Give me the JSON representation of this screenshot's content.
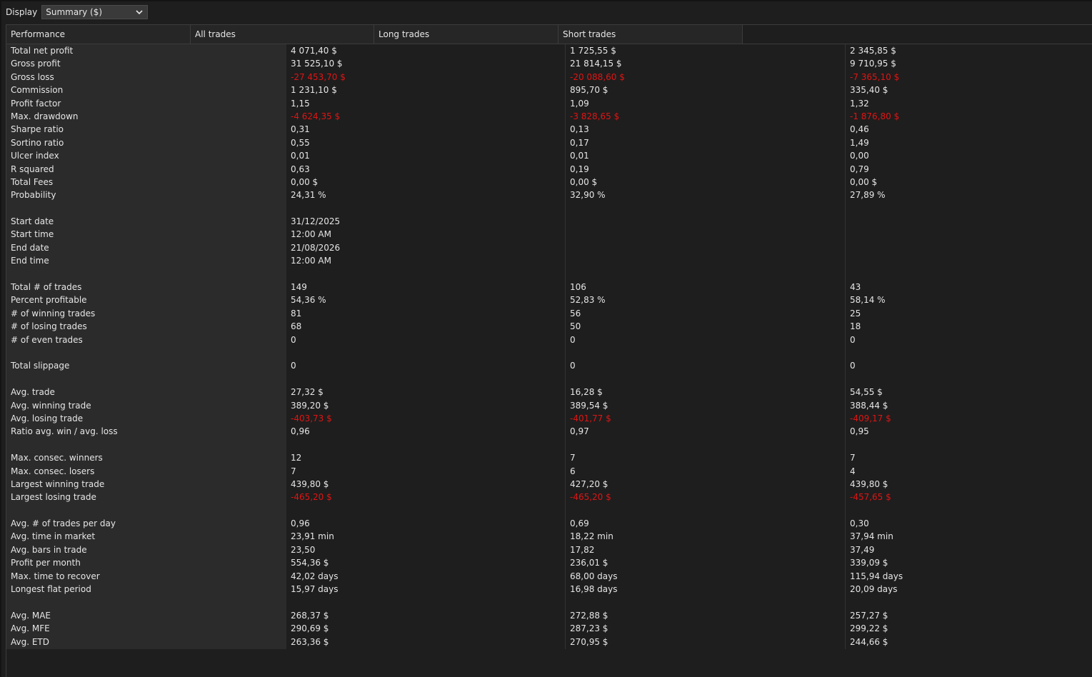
{
  "toolbar": {
    "display_label": "Display",
    "display_value": "Summary ($)"
  },
  "columns": [
    "Performance",
    "All trades",
    "Long trades",
    "Short trades"
  ],
  "colors": {
    "negative": "#e01414",
    "text": "#e6e6e6",
    "background": "#1e1e1e",
    "label_column": "#2b2b2b"
  },
  "rows": [
    {
      "label": "Total net profit",
      "all": "4 071,40 $",
      "long": "1 725,55 $",
      "short": "2 345,85 $",
      "neg": false
    },
    {
      "label": "Gross profit",
      "all": "31 525,10 $",
      "long": "21 814,15 $",
      "short": "9 710,95 $",
      "neg": false
    },
    {
      "label": "Gross loss",
      "all": "-27 453,70 $",
      "long": "-20 088,60 $",
      "short": "-7 365,10 $",
      "neg": true
    },
    {
      "label": "Commission",
      "all": "1 231,10 $",
      "long": "895,70 $",
      "short": "335,40 $",
      "neg": false
    },
    {
      "label": "Profit factor",
      "all": "1,15",
      "long": "1,09",
      "short": "1,32",
      "neg": false
    },
    {
      "label": "Max. drawdown",
      "all": "-4 624,35 $",
      "long": "-3 828,65 $",
      "short": "-1 876,80 $",
      "neg": true
    },
    {
      "label": "Sharpe ratio",
      "all": "0,31",
      "long": "0,13",
      "short": "0,46",
      "neg": false
    },
    {
      "label": "Sortino ratio",
      "all": "0,55",
      "long": "0,17",
      "short": "1,49",
      "neg": false
    },
    {
      "label": "Ulcer index",
      "all": "0,01",
      "long": "0,01",
      "short": "0,00",
      "neg": false
    },
    {
      "label": "R squared",
      "all": "0,63",
      "long": "0,19",
      "short": "0,79",
      "neg": false
    },
    {
      "label": "Total Fees",
      "all": "0,00 $",
      "long": "0,00 $",
      "short": "0,00 $",
      "neg": false
    },
    {
      "label": "Probability",
      "all": "24,31 %",
      "long": "32,90 %",
      "short": "27,89 %",
      "neg": false
    },
    {
      "label": "",
      "all": "",
      "long": "",
      "short": "",
      "neg": false
    },
    {
      "label": "Start date",
      "all": "31/12/2025",
      "long": "",
      "short": "",
      "neg": false
    },
    {
      "label": "Start time",
      "all": "12:00 AM",
      "long": "",
      "short": "",
      "neg": false
    },
    {
      "label": "End date",
      "all": "21/08/2026",
      "long": "",
      "short": "",
      "neg": false
    },
    {
      "label": "End time",
      "all": "12:00 AM",
      "long": "",
      "short": "",
      "neg": false
    },
    {
      "label": "",
      "all": "",
      "long": "",
      "short": "",
      "neg": false
    },
    {
      "label": "Total # of trades",
      "all": "149",
      "long": "106",
      "short": "43",
      "neg": false
    },
    {
      "label": "Percent profitable",
      "all": "54,36 %",
      "long": "52,83 %",
      "short": "58,14 %",
      "neg": false
    },
    {
      "label": "# of winning trades",
      "all": "81",
      "long": "56",
      "short": "25",
      "neg": false
    },
    {
      "label": "# of losing trades",
      "all": "68",
      "long": "50",
      "short": "18",
      "neg": false
    },
    {
      "label": "# of even trades",
      "all": "0",
      "long": "0",
      "short": "0",
      "neg": false
    },
    {
      "label": "",
      "all": "",
      "long": "",
      "short": "",
      "neg": false
    },
    {
      "label": "Total slippage",
      "all": "0",
      "long": "0",
      "short": "0",
      "neg": false
    },
    {
      "label": "",
      "all": "",
      "long": "",
      "short": "",
      "neg": false
    },
    {
      "label": "Avg. trade",
      "all": "27,32 $",
      "long": "16,28 $",
      "short": "54,55 $",
      "neg": false
    },
    {
      "label": "Avg. winning trade",
      "all": "389,20 $",
      "long": "389,54 $",
      "short": "388,44 $",
      "neg": false
    },
    {
      "label": "Avg. losing trade",
      "all": "-403,73 $",
      "long": "-401,77 $",
      "short": "-409,17 $",
      "neg": true
    },
    {
      "label": "Ratio avg. win / avg. loss",
      "all": "0,96",
      "long": "0,97",
      "short": "0,95",
      "neg": false
    },
    {
      "label": "",
      "all": "",
      "long": "",
      "short": "",
      "neg": false
    },
    {
      "label": "Max. consec. winners",
      "all": "12",
      "long": "7",
      "short": "7",
      "neg": false
    },
    {
      "label": "Max. consec. losers",
      "all": "7",
      "long": "6",
      "short": "4",
      "neg": false
    },
    {
      "label": "Largest winning trade",
      "all": "439,80 $",
      "long": "427,20 $",
      "short": "439,80 $",
      "neg": false
    },
    {
      "label": "Largest losing trade",
      "all": "-465,20 $",
      "long": "-465,20 $",
      "short": "-457,65 $",
      "neg": true
    },
    {
      "label": "",
      "all": "",
      "long": "",
      "short": "",
      "neg": false
    },
    {
      "label": "Avg. # of trades per day",
      "all": "0,96",
      "long": "0,69",
      "short": "0,30",
      "neg": false
    },
    {
      "label": "Avg. time in market",
      "all": "23,91 min",
      "long": "18,22 min",
      "short": "37,94 min",
      "neg": false
    },
    {
      "label": "Avg. bars in trade",
      "all": "23,50",
      "long": "17,82",
      "short": "37,49",
      "neg": false
    },
    {
      "label": "Profit per month",
      "all": "554,36 $",
      "long": "236,01 $",
      "short": "339,09 $",
      "neg": false
    },
    {
      "label": "Max. time to recover",
      "all": "42,02 days",
      "long": "68,00 days",
      "short": "115,94 days",
      "neg": false
    },
    {
      "label": "Longest flat period",
      "all": "15,97 days",
      "long": "16,98 days",
      "short": "20,09 days",
      "neg": false
    },
    {
      "label": "",
      "all": "",
      "long": "",
      "short": "",
      "neg": false
    },
    {
      "label": "Avg. MAE",
      "all": "268,37 $",
      "long": "272,88 $",
      "short": "257,27 $",
      "neg": false
    },
    {
      "label": "Avg. MFE",
      "all": "290,69 $",
      "long": "287,23 $",
      "short": "299,22 $",
      "neg": false
    },
    {
      "label": "Avg. ETD",
      "all": "263,36 $",
      "long": "270,95 $",
      "short": "244,66 $",
      "neg": false
    }
  ]
}
